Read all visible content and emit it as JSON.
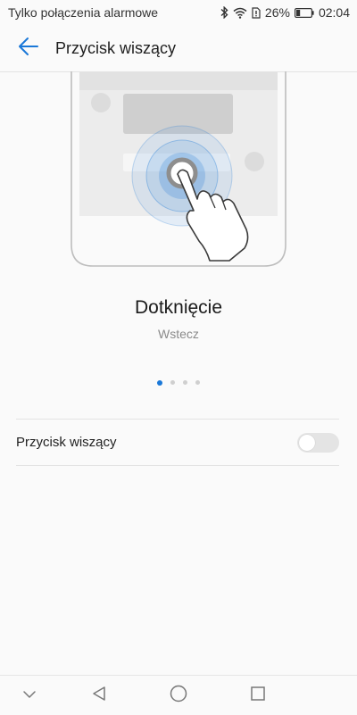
{
  "status_bar": {
    "carrier_text": "Tylko połączenia alarmowe",
    "battery_percent": "26%",
    "time": "02:04",
    "battery_level": 0.26,
    "icons": [
      "bluetooth-icon",
      "wifi-icon",
      "sim-doc-icon",
      "battery-icon"
    ]
  },
  "header": {
    "title": "Przycisk wiszący",
    "back_icon": "arrow-left-icon"
  },
  "illustration": {
    "name": "phone-tap-gesture",
    "accent": "#1a78d8"
  },
  "gesture": {
    "title": "Dotknięcie",
    "subtitle": "Wstecz"
  },
  "pager": {
    "count": 4,
    "active_index": 0
  },
  "settings": {
    "floating_button": {
      "label": "Przycisk wiszący",
      "enabled": false
    }
  },
  "nav_bar": {
    "icons": [
      "chevron-down-icon",
      "back-triangle-icon",
      "home-circle-icon",
      "recents-square-icon"
    ]
  },
  "colors": {
    "accent": "#1a78d8",
    "background": "#fafafa",
    "divider": "#e3e3e3"
  }
}
